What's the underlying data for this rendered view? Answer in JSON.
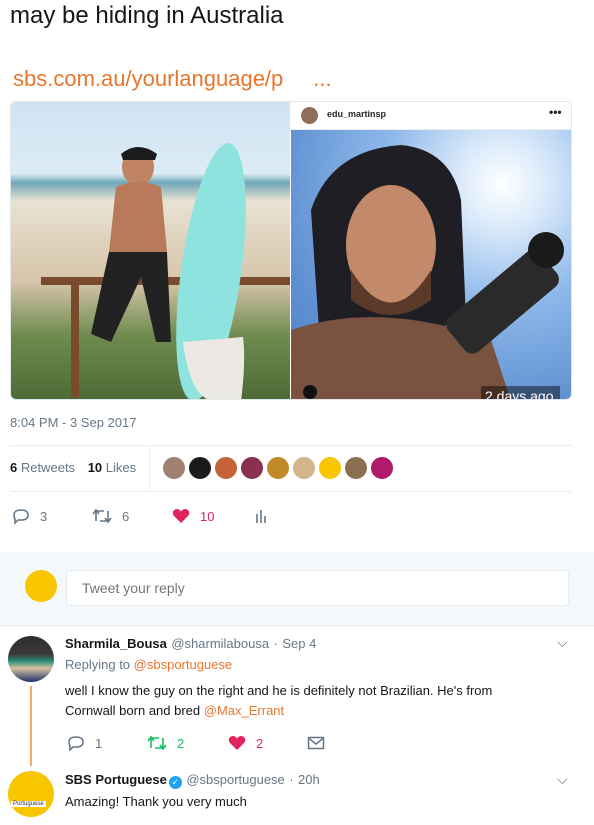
{
  "tweet": {
    "text": "may be hiding in Australia",
    "link_text": "sbs.com.au/yourlanguage/p",
    "link_ellipsis": "...",
    "media": {
      "right_photo_username": "edu_martinsp",
      "right_photo_more": "•••",
      "time_ago": "2 days ago"
    },
    "timestamp": "8:04 PM - 3 Sep 2017",
    "retweets_count": "6",
    "retweets_label": "Retweets",
    "likes_count": "10",
    "likes_label": "Likes",
    "actions": {
      "reply_count": "3",
      "retweet_count": "6",
      "like_count": "10"
    }
  },
  "reply_box": {
    "placeholder": "Tweet your reply"
  },
  "replies": [
    {
      "name": "Sharmila_Bousa",
      "handle": "@sharmilabousa",
      "sep": "·",
      "date": "Sep 4",
      "replying_prefix": "Replying to",
      "replying_to": "@sbsportuguese",
      "text_line1": "well I know the guy on the right and he is definitely not Brazilian. He's from",
      "text_line2": "Cornwall born and bred",
      "mention": "@Max_Errant",
      "reply_count": "1",
      "retweet_count": "2",
      "like_count": "2"
    },
    {
      "name": "SBS Portuguese",
      "handle": "@sbsportuguese",
      "sep": "·",
      "date": "20h",
      "text": "Amazing! Thank you very much",
      "avatar_caption": "Portuguese"
    }
  ],
  "colors": {
    "link": "#e8752c",
    "like_heart": "#e0245e",
    "retweet_green": "#17bf63",
    "muted": "#657786",
    "sbs_yellow": "#f7c600"
  }
}
